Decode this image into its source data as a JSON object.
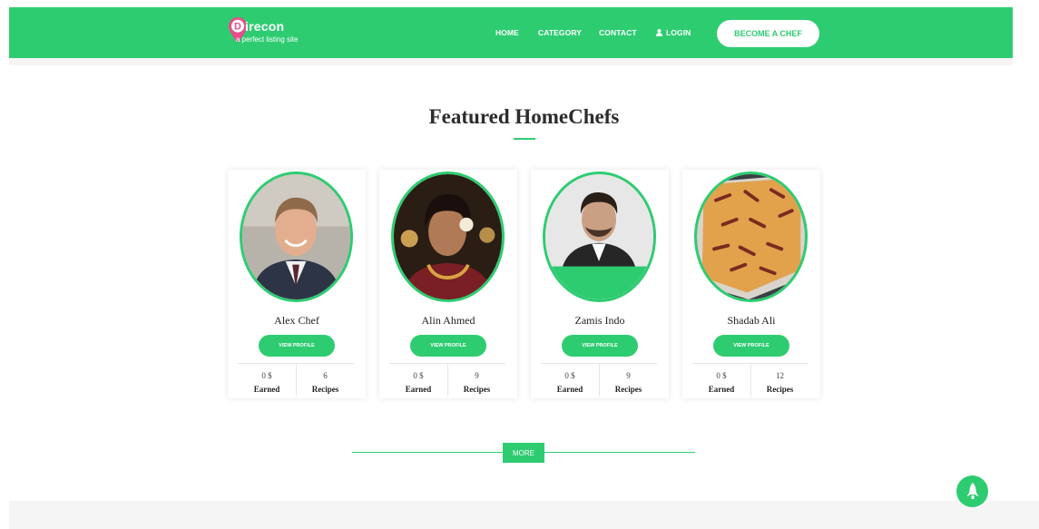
{
  "colors": {
    "brand": "#2ecc71",
    "text_dark": "#2c2c2c",
    "background": "#ffffff",
    "band": "#f5f5f5",
    "logo_pin": "#e84c8a"
  },
  "header": {
    "logo": {
      "name": "irecon",
      "letter": "D",
      "tagline": "a perfect listing site",
      "icon": "map-pin-icon"
    },
    "nav": {
      "home": "HOME",
      "category": "CATEGORY",
      "contact": "CONTACT",
      "login": "LOGIN",
      "login_icon": "user-icon"
    },
    "cta": "BECOME A CHEF"
  },
  "featured": {
    "title": "Featured HomeChefs",
    "view_profile_label": "VIEW PROFILE",
    "earned_label": "Earned",
    "recipes_label": "Recipes",
    "chefs": [
      {
        "name": "Alex Chef",
        "earned": "0 $",
        "recipes": "6"
      },
      {
        "name": "Alin Ahmed",
        "earned": "0 $",
        "recipes": "9"
      },
      {
        "name": "Zamis Indo",
        "earned": "0 $",
        "recipes": "9"
      },
      {
        "name": "Shadab Ali",
        "earned": "0 $",
        "recipes": "12"
      }
    ]
  },
  "more_label": "MORE",
  "scroll_top_icon": "rocket-icon"
}
